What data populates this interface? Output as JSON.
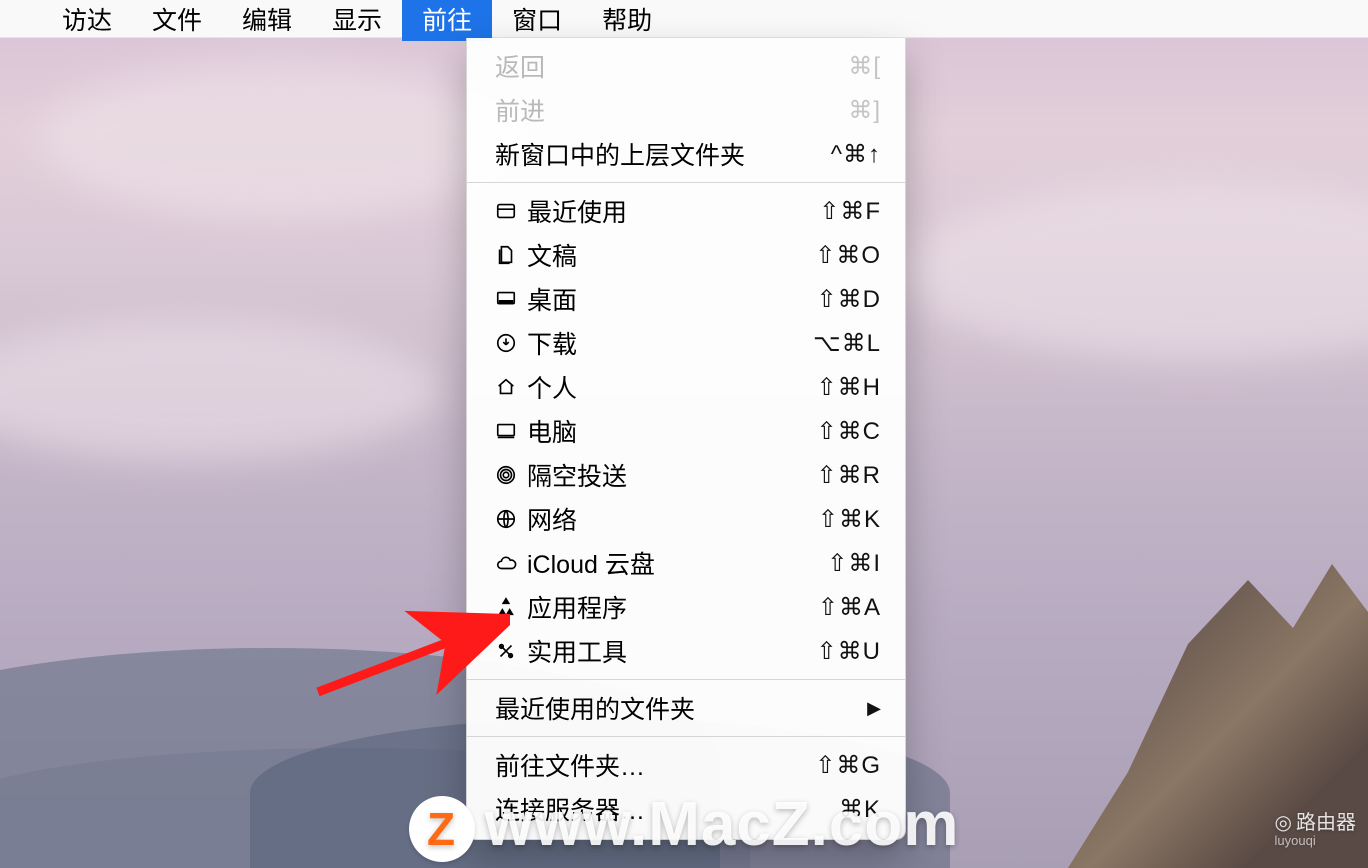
{
  "menubar": {
    "items": [
      {
        "label": "访达"
      },
      {
        "label": "文件"
      },
      {
        "label": "编辑"
      },
      {
        "label": "显示"
      },
      {
        "label": "前往",
        "selected": true
      },
      {
        "label": "窗口"
      },
      {
        "label": "帮助"
      }
    ]
  },
  "dropdown": {
    "sections": [
      [
        {
          "label": "返回",
          "shortcut": "⌘[",
          "disabled": true
        },
        {
          "label": "前进",
          "shortcut": "⌘]",
          "disabled": true
        },
        {
          "label": "新窗口中的上层文件夹",
          "shortcut": "^⌘↑"
        }
      ],
      [
        {
          "icon": "recents",
          "label": "最近使用",
          "shortcut": "⇧⌘F"
        },
        {
          "icon": "documents",
          "label": "文稿",
          "shortcut": "⇧⌘O"
        },
        {
          "icon": "desktop",
          "label": "桌面",
          "shortcut": "⇧⌘D"
        },
        {
          "icon": "downloads",
          "label": "下载",
          "shortcut": "⌥⌘L"
        },
        {
          "icon": "home",
          "label": "个人",
          "shortcut": "⇧⌘H"
        },
        {
          "icon": "computer",
          "label": "电脑",
          "shortcut": "⇧⌘C"
        },
        {
          "icon": "airdrop",
          "label": "隔空投送",
          "shortcut": "⇧⌘R"
        },
        {
          "icon": "network",
          "label": "网络",
          "shortcut": "⇧⌘K"
        },
        {
          "icon": "icloud",
          "label": "iCloud 云盘",
          "shortcut": "⇧⌘I"
        },
        {
          "icon": "applications",
          "label": "应用程序",
          "shortcut": "⇧⌘A"
        },
        {
          "icon": "utilities",
          "label": "实用工具",
          "shortcut": "⇧⌘U"
        }
      ],
      [
        {
          "label": "最近使用的文件夹",
          "submenu": true
        }
      ],
      [
        {
          "label": "前往文件夹…",
          "shortcut": "⇧⌘G"
        },
        {
          "label": "连接服务器…",
          "shortcut": "⌘K"
        }
      ]
    ]
  },
  "watermark": {
    "badge": "Z",
    "text": "www.MacZ.com"
  },
  "router_badge": {
    "label": "路由器",
    "sub": "luyouqi"
  }
}
